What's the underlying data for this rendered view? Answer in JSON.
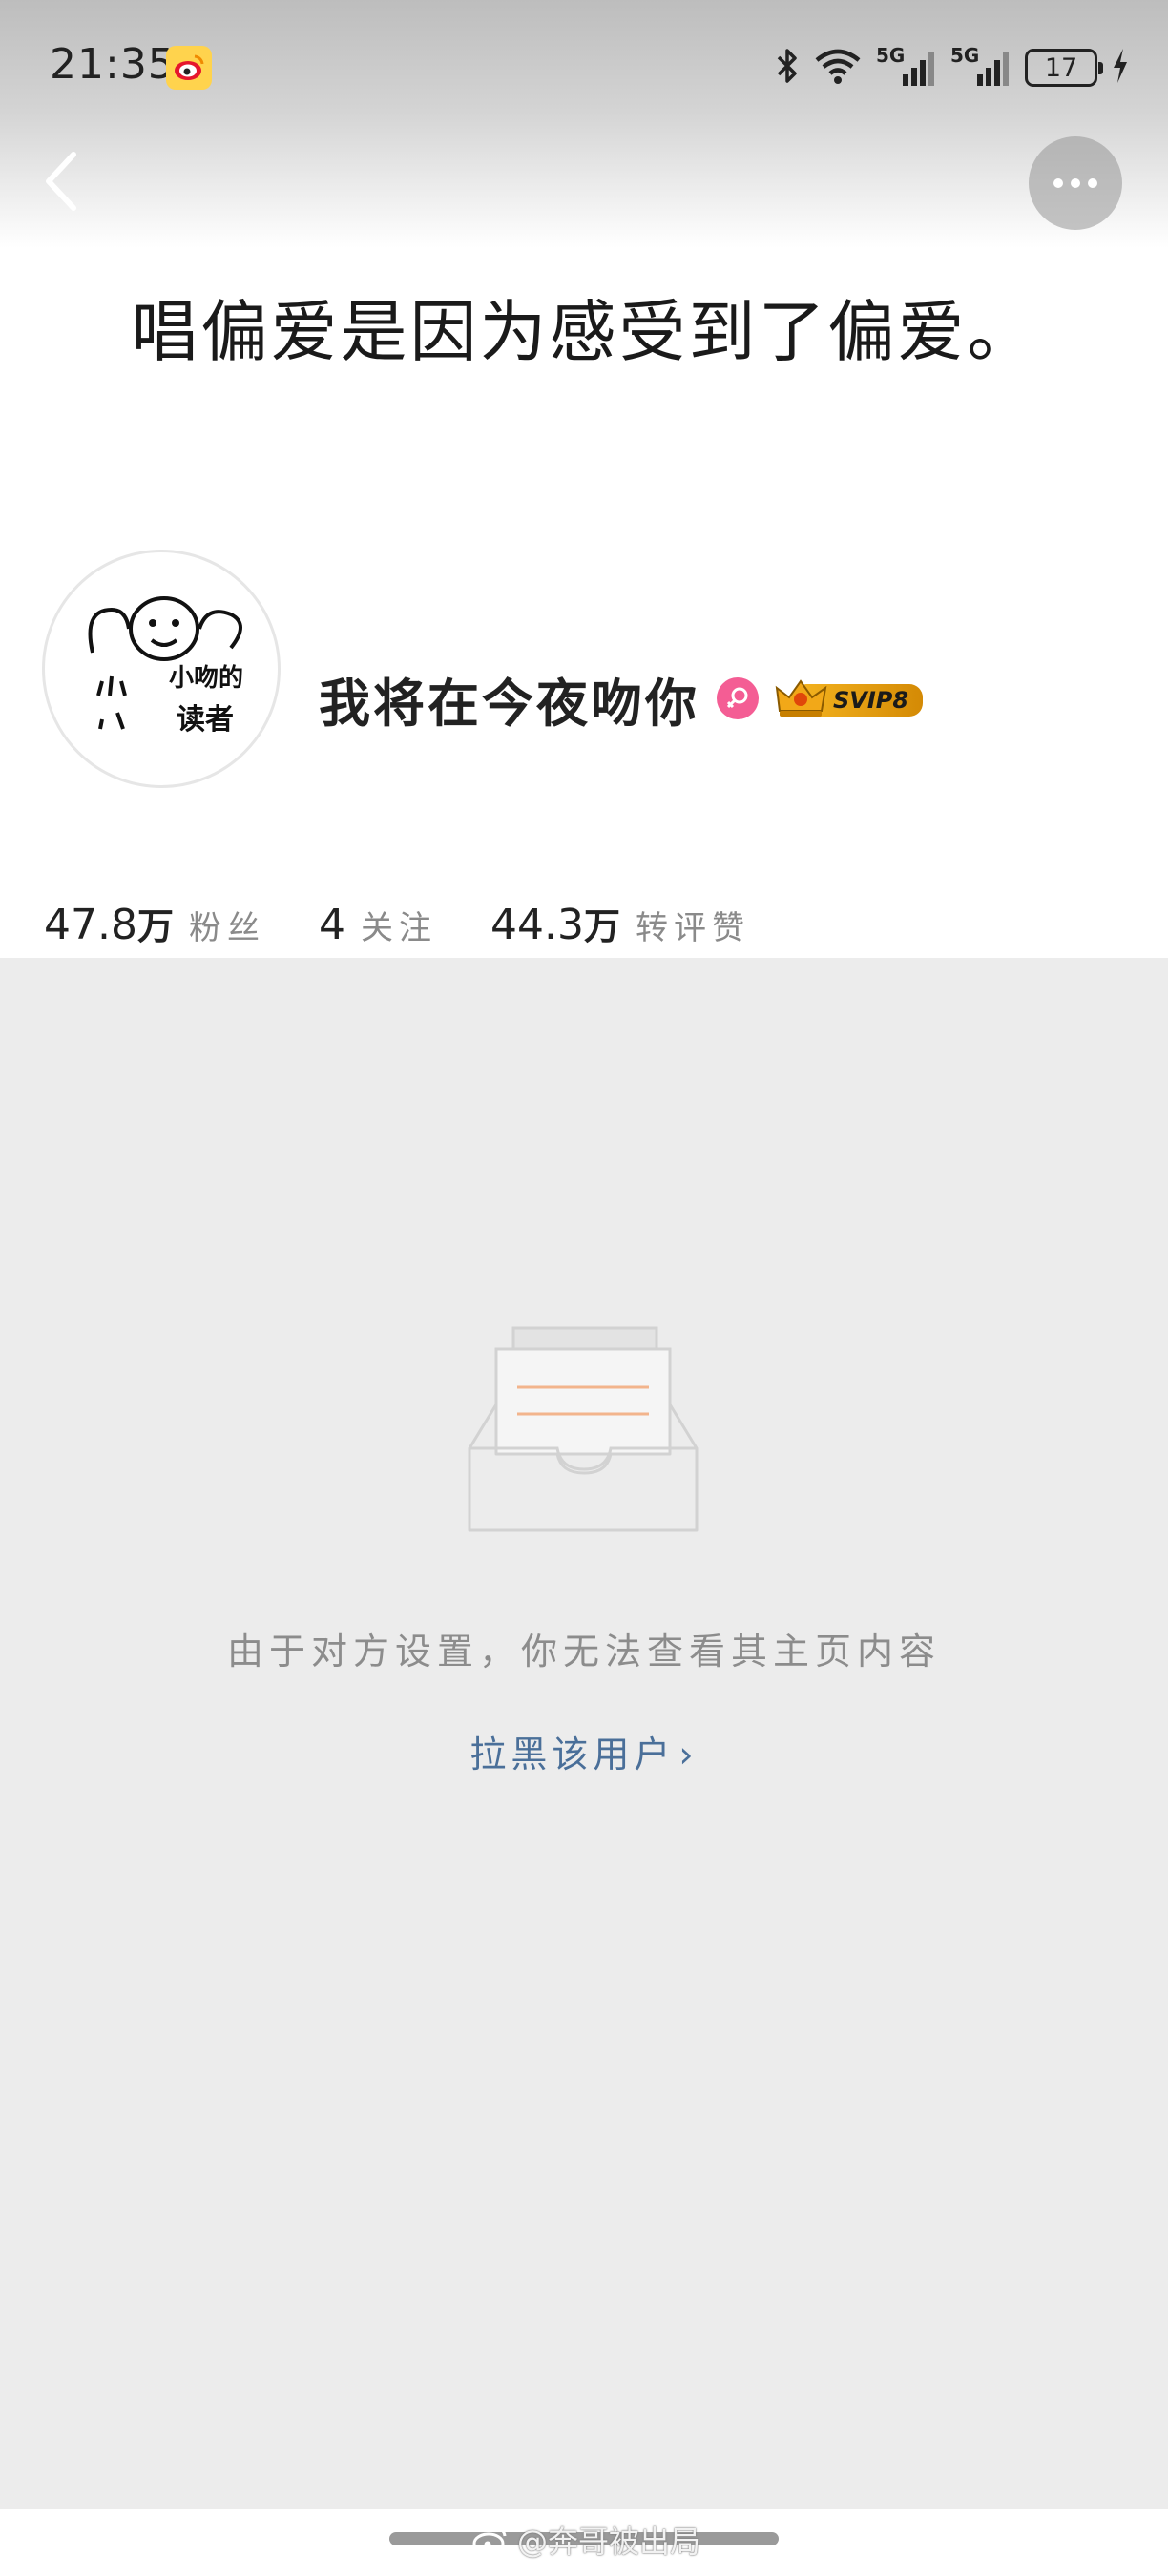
{
  "status_bar": {
    "time": "21:35",
    "network_1": "5G",
    "network_2": "5G",
    "battery": "17"
  },
  "cover": {
    "text": "唱偏爱是因为感受到了偏爱。"
  },
  "profile": {
    "nickname": "我将在今夜吻你",
    "vip_badge": "SVIP8",
    "avatar_text": "小吻的读者"
  },
  "stats": [
    {
      "number": "47.8",
      "unit": "万",
      "label": "粉丝"
    },
    {
      "number": "4",
      "unit": "",
      "label": "关注"
    },
    {
      "number": "44.3",
      "unit": "万",
      "label": "转评赞"
    }
  ],
  "empty_state": {
    "message": "由于对方设置，你无法查看其主页内容",
    "block_link": "拉黑该用户",
    "chevron": "›"
  },
  "watermark": "@奔哥被出局",
  "colors": {
    "page_background": "#ececec",
    "link": "#4a6f99",
    "gender_female": "#f45d94",
    "svip_gold": "#f3b21f"
  }
}
